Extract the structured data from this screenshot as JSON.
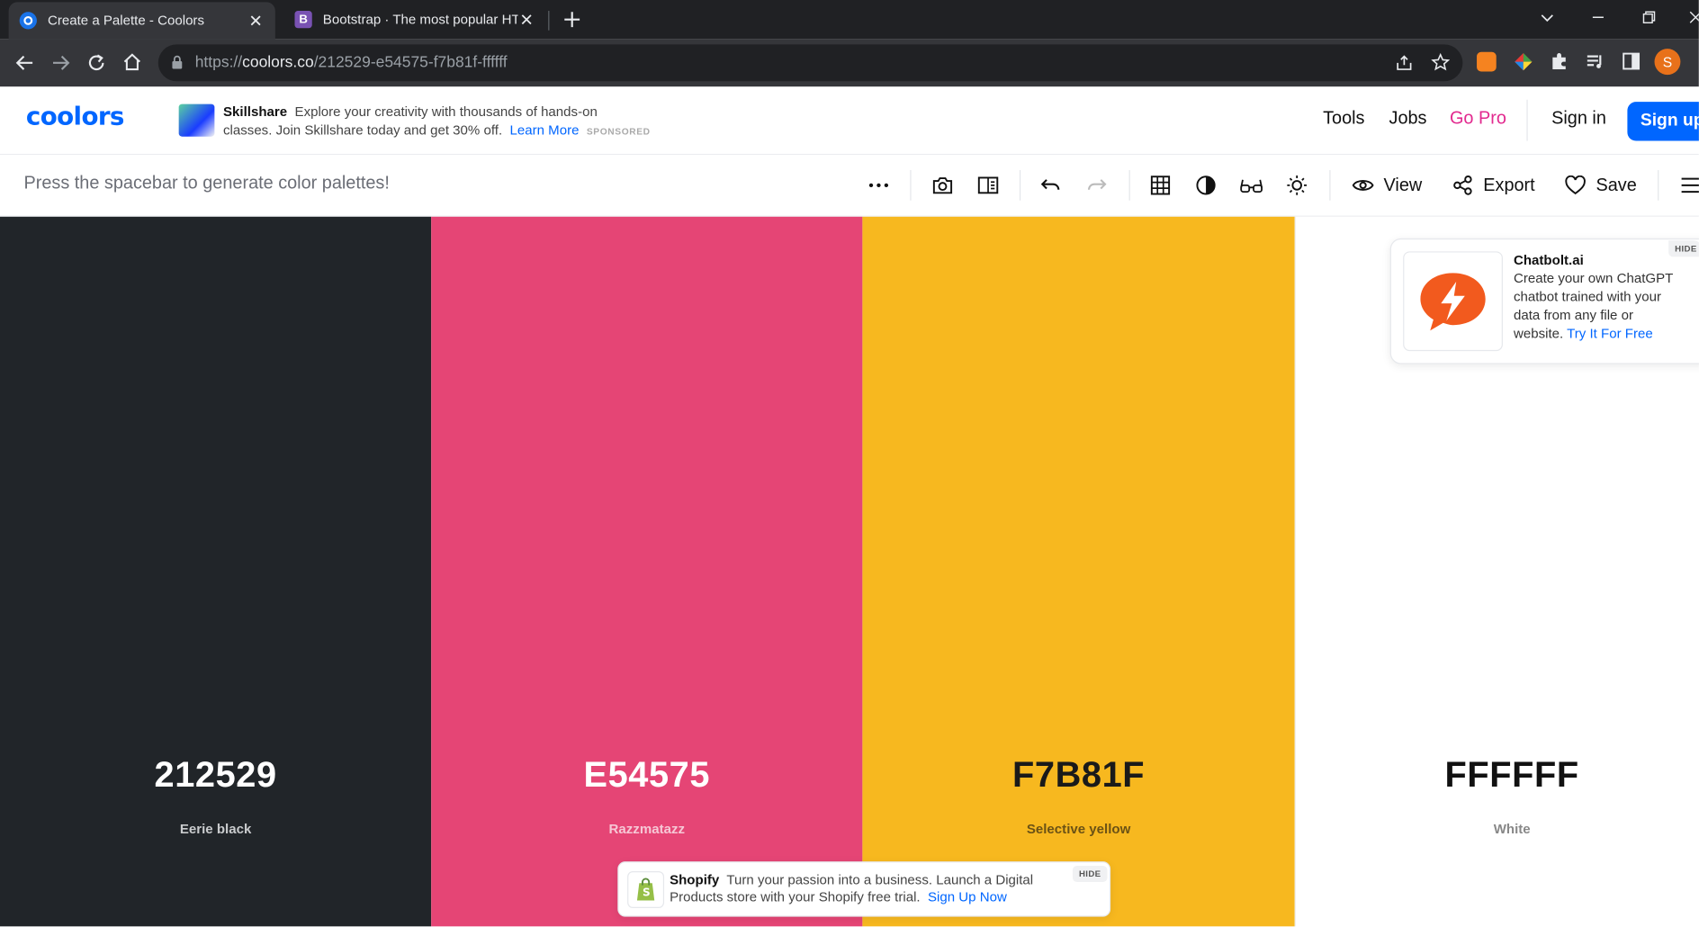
{
  "browser": {
    "tabs": [
      {
        "title": "Create a Palette - Coolors",
        "favicon": "coolors-icon"
      },
      {
        "title": "Bootstrap · The most popular HTML",
        "favicon": "bootstrap-icon"
      }
    ],
    "url": {
      "scheme": "https://",
      "host": "coolors.co",
      "path": "/212529-e54575-f7b81f-ffffff"
    },
    "profile_initial": "S"
  },
  "header": {
    "logo": "coolors",
    "ad": {
      "brand": "Skillshare",
      "line1": "Explore your creativity with thousands of hands-on",
      "line2": "classes. Join Skillshare today and get 30% off.",
      "cta": "Learn More",
      "tag": "SPONSORED"
    },
    "nav": {
      "tools": "Tools",
      "jobs": "Jobs",
      "gopro": "Go Pro",
      "signin": "Sign in",
      "signup": "Sign up"
    }
  },
  "toolbar": {
    "hint": "Press the spacebar to generate color palettes!",
    "view": "View",
    "export": "Export",
    "save": "Save"
  },
  "palette": [
    {
      "hex": "212529",
      "name": "Eerie black",
      "color": "#212529",
      "text": "#ffffff",
      "sub": "#c9cbcd"
    },
    {
      "hex": "E54575",
      "name": "Razzmatazz",
      "color": "#e54575",
      "text": "#ffffff",
      "sub": "#f6c7d5"
    },
    {
      "hex": "F7B81F",
      "name": "Selective yellow",
      "color": "#f7b81f",
      "text": "#1a1a1a",
      "sub": "#6b5215"
    },
    {
      "hex": "FFFFFF",
      "name": "White",
      "color": "#ffffff",
      "text": "#111111",
      "sub": "#888888"
    }
  ],
  "ad_right": {
    "brand": "Chatbolt.ai",
    "line1": "Create your own ChatGPT",
    "line2": "chatbot trained with your",
    "line3": "data from any file or",
    "line4": "website.",
    "cta": "Try It For Free",
    "hide": "HIDE"
  },
  "ad_bottom": {
    "brand": "Shopify",
    "line1": "Turn your passion into a business. Launch a Digital",
    "line2": "Products store with your Shopify free trial.",
    "cta": "Sign Up Now",
    "hide": "HIDE"
  }
}
